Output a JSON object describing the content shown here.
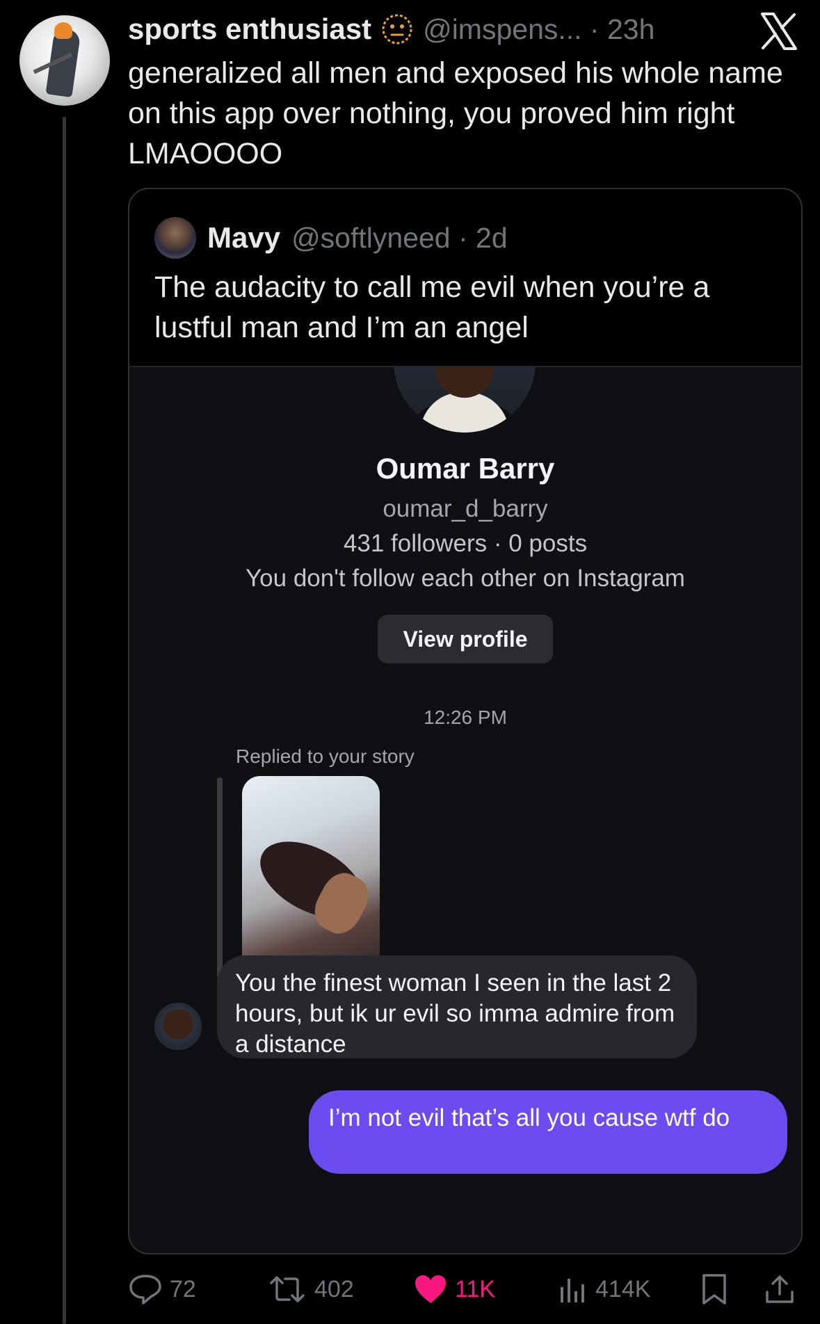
{
  "tweet": {
    "display_name": "sports enthusiast",
    "handle_time": "@imspens... · 23h",
    "text": "generalized all men and exposed his whole name on this app over nothing, you proved him right LMAOOOO"
  },
  "quote": {
    "name": "Mavy",
    "handle_time": "@softlyneed · 2d",
    "text": "The audacity to call me evil when you’re a lustful man and I’m an angel"
  },
  "ig": {
    "name": "Oumar Barry",
    "username": "oumar_d_barry",
    "stats": "431 followers · 0 posts",
    "follow_note": "You don't follow each other on Instagram",
    "view_profile": "View profile",
    "time": "12:26 PM",
    "replied_label": "Replied to your story",
    "message": "You the finest woman I seen in the last 2 hours, but ik ur evil so imma admire from a distance",
    "my_message": "I’m not evil that’s all you cause wtf do"
  },
  "actions": {
    "replies": "72",
    "reposts": "402",
    "likes": "11K",
    "views": "414K"
  },
  "colors": {
    "background": "#000000",
    "text": "#e7e9ea",
    "muted": "#71767b",
    "like": "#f91880",
    "my_bubble": "#6a4cf0"
  },
  "icons": [
    "neutral-face-emoji-icon",
    "x-logo-icon",
    "reply-icon",
    "repost-icon",
    "heart-icon",
    "views-icon",
    "bookmark-icon",
    "share-icon"
  ]
}
